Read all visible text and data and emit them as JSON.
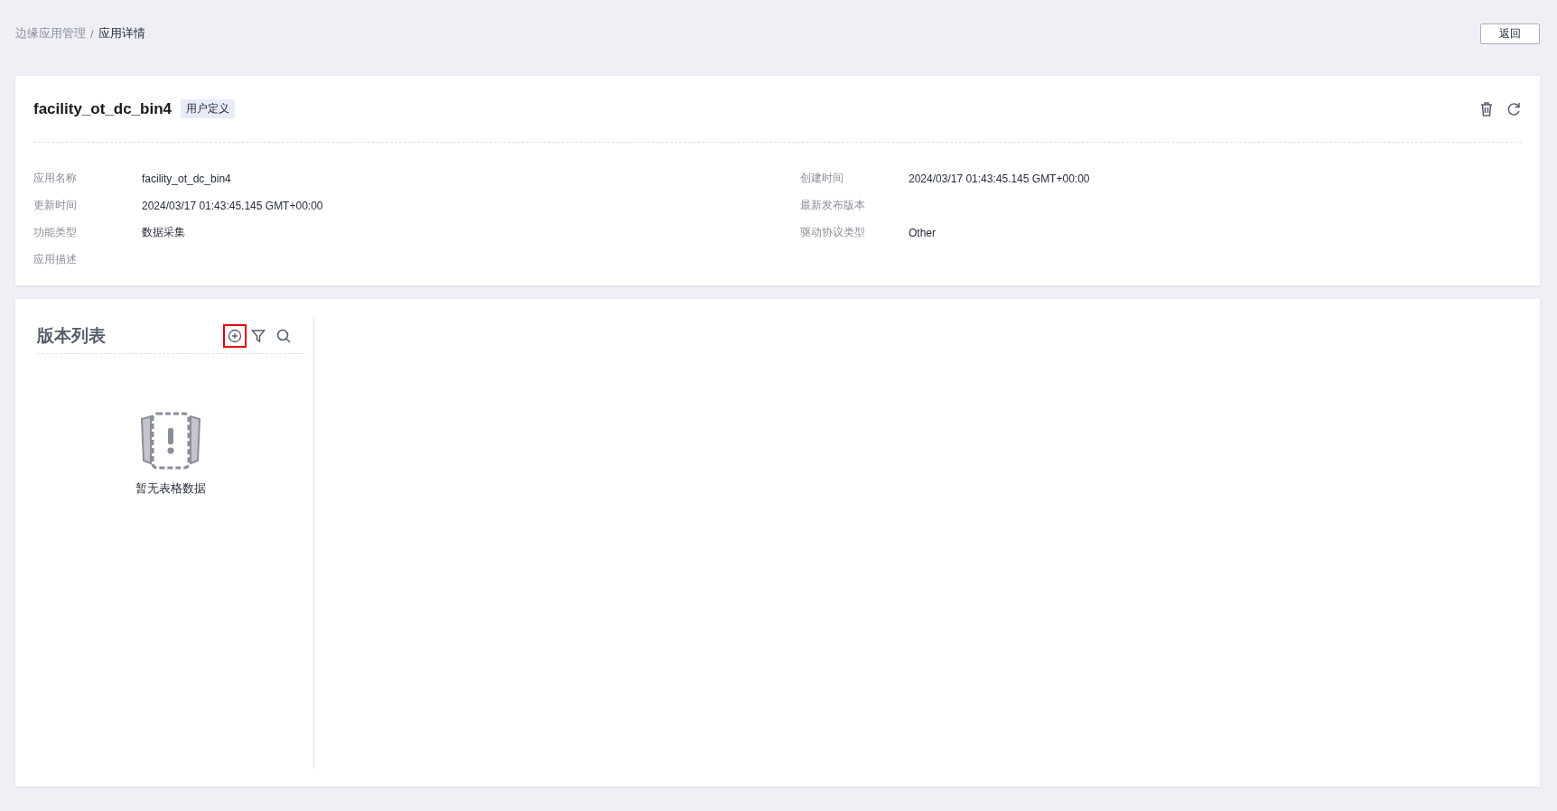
{
  "breadcrumb": [
    {
      "label": "边缘应用管理",
      "current": false
    },
    {
      "label": "应用详情",
      "current": true
    }
  ],
  "breadcrumb_separator": "/",
  "back_button": "返回",
  "app": {
    "title": "facility_ot_dc_bin4",
    "tag": "用户定义"
  },
  "details_left": [
    {
      "label": "应用名称",
      "value": "facility_ot_dc_bin4"
    },
    {
      "label": "更新时间",
      "value": "2024/03/17 01:43:45.145 GMT+00:00"
    },
    {
      "label": "功能类型",
      "value": "数据采集"
    },
    {
      "label": "应用描述"
    }
  ],
  "details_right": [
    {
      "label": "创建时间",
      "value": "2024/03/17 01:43:45.145 GMT+00:00"
    },
    {
      "label": "最新发布版本"
    },
    {
      "label": "驱动协议类型",
      "value": "Other"
    }
  ],
  "version_list": {
    "title": "版本列表",
    "add_highlighted": true,
    "empty_text": "暂无表格数据"
  }
}
